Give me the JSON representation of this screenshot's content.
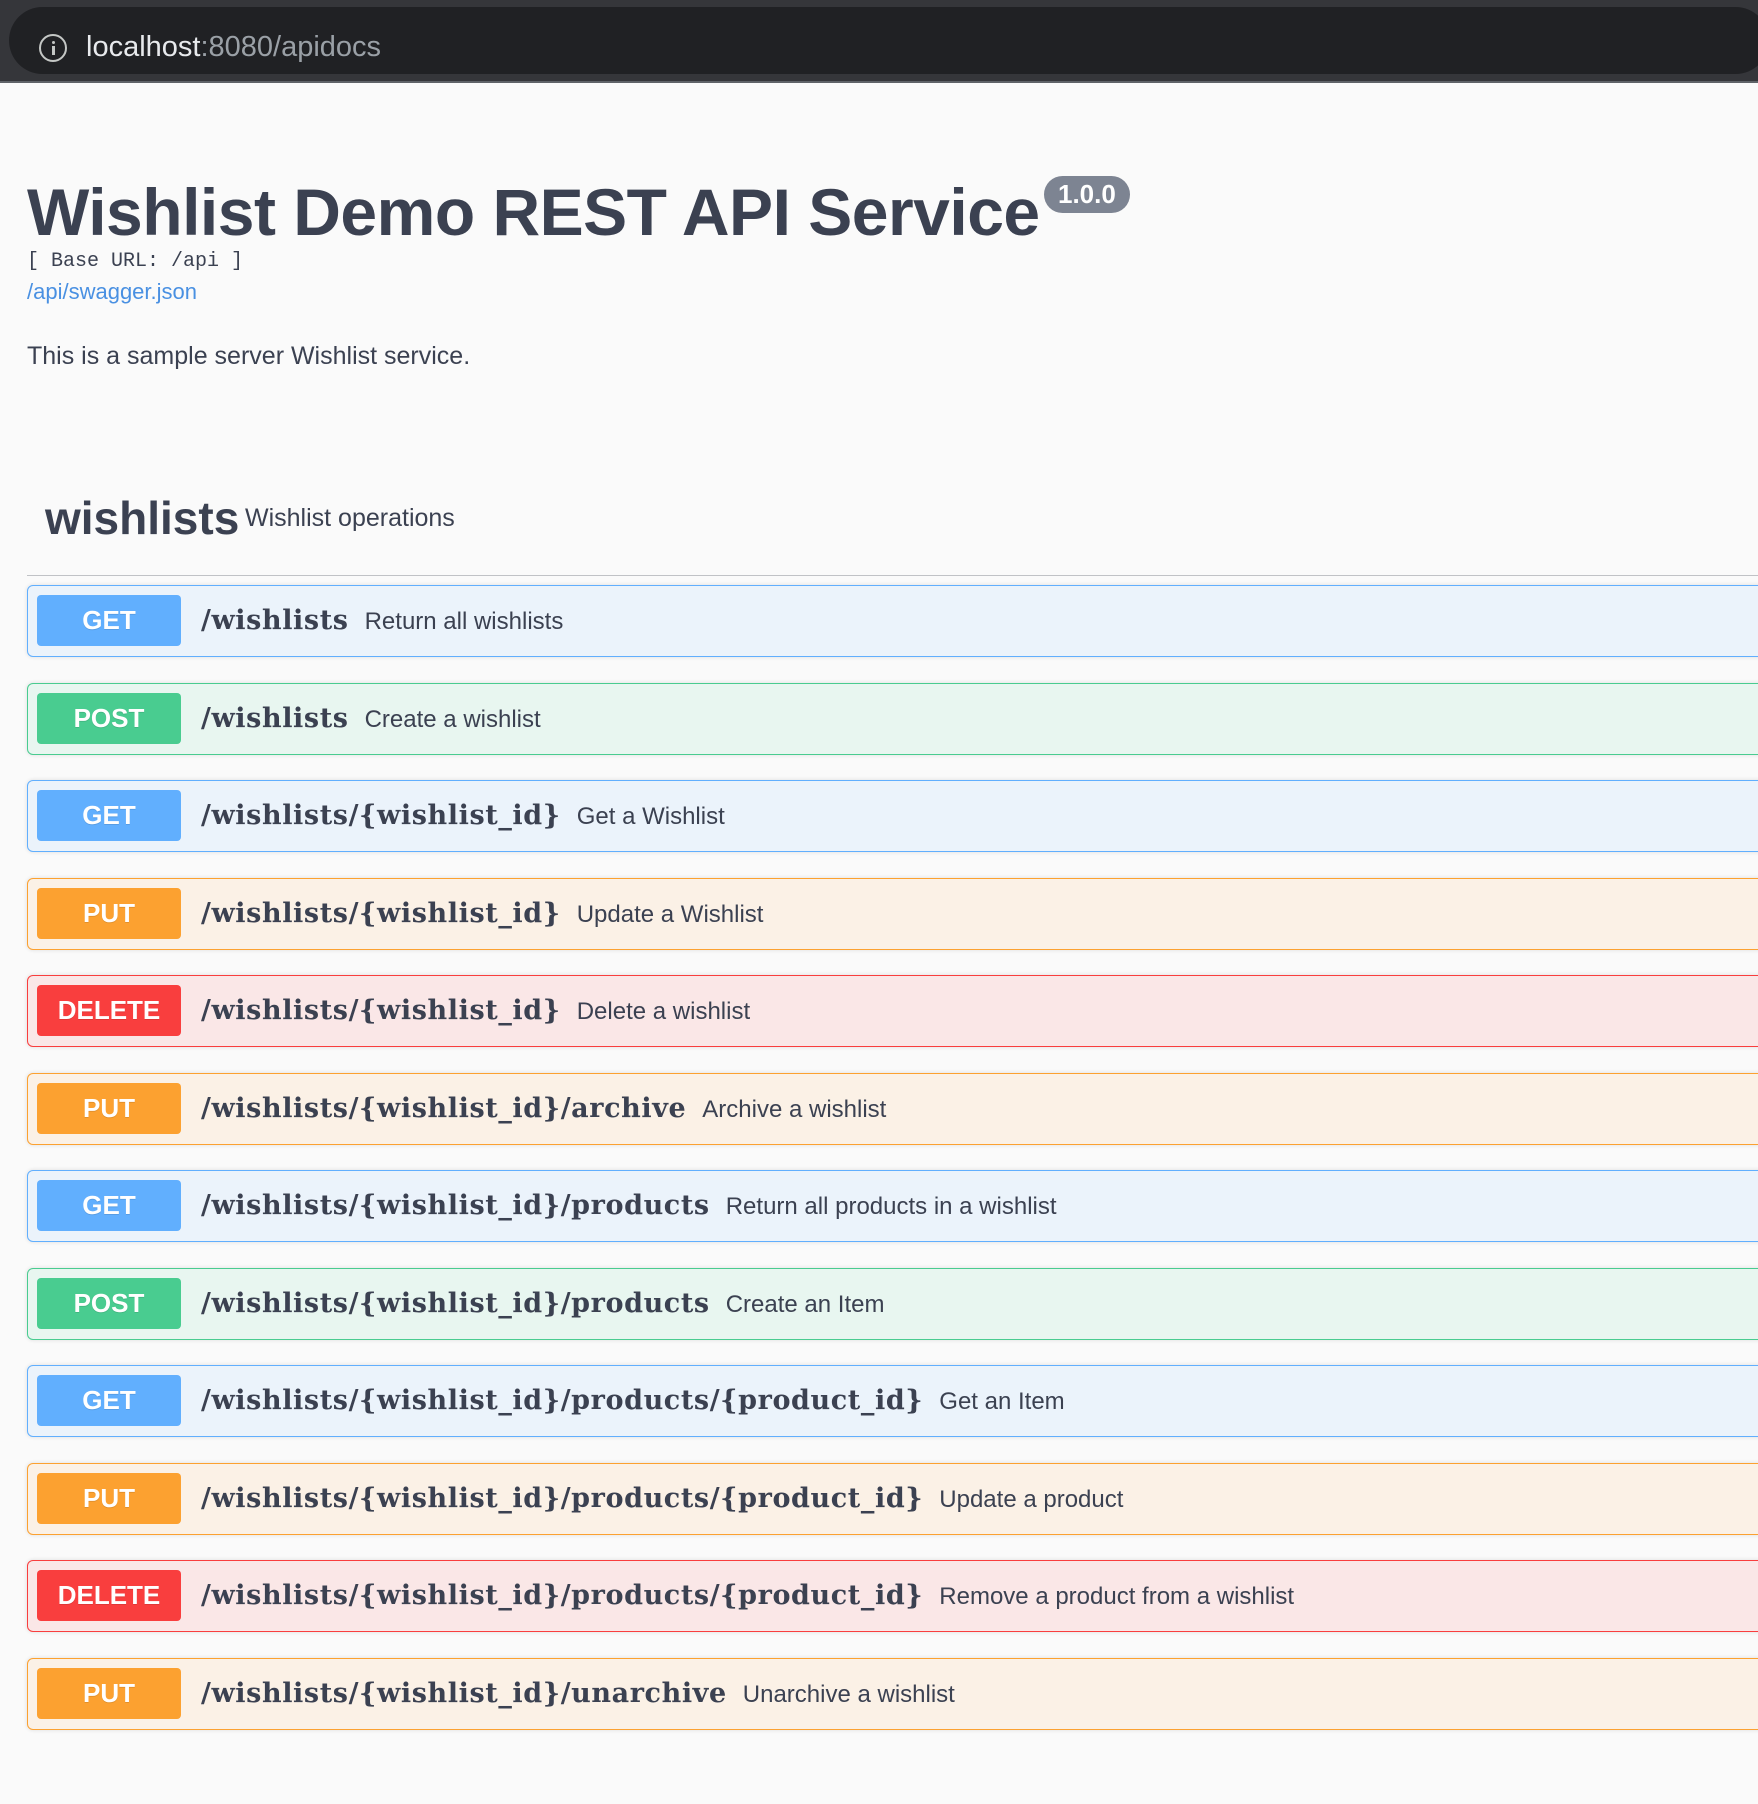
{
  "browser": {
    "url_host": "localhost",
    "url_path": ":8080/apidocs"
  },
  "info": {
    "title": "Wishlist Demo REST API Service",
    "version": "1.0.0",
    "base_url": "[ Base URL: /api ]",
    "spec_link": "/api/swagger.json",
    "description": "This is a sample server Wishlist service."
  },
  "tag": {
    "name": "wishlists",
    "description": "Wishlist operations"
  },
  "colors": {
    "get": "#61affe",
    "post": "#49cc90",
    "put": "#fca130",
    "delete": "#f93e3e"
  },
  "operations": [
    {
      "method": "GET",
      "path": "/wishlists",
      "summary": "Return all wishlists"
    },
    {
      "method": "POST",
      "path": "/wishlists",
      "summary": "Create a wishlist"
    },
    {
      "method": "GET",
      "path": "/wishlists/{wishlist_id}",
      "summary": "Get a Wishlist"
    },
    {
      "method": "PUT",
      "path": "/wishlists/{wishlist_id}",
      "summary": "Update a Wishlist"
    },
    {
      "method": "DELETE",
      "path": "/wishlists/{wishlist_id}",
      "summary": "Delete a wishlist"
    },
    {
      "method": "PUT",
      "path": "/wishlists/{wishlist_id}/archive",
      "summary": "Archive a wishlist"
    },
    {
      "method": "GET",
      "path": "/wishlists/{wishlist_id}/products",
      "summary": "Return all products in a wishlist"
    },
    {
      "method": "POST",
      "path": "/wishlists/{wishlist_id}/products",
      "summary": "Create an Item"
    },
    {
      "method": "GET",
      "path": "/wishlists/{wishlist_id}/products/{product_id}",
      "summary": "Get an Item"
    },
    {
      "method": "PUT",
      "path": "/wishlists/{wishlist_id}/products/{product_id}",
      "summary": "Update a product"
    },
    {
      "method": "DELETE",
      "path": "/wishlists/{wishlist_id}/products/{product_id}",
      "summary": "Remove a product from a wishlist"
    },
    {
      "method": "PUT",
      "path": "/wishlists/{wishlist_id}/unarchive",
      "summary": "Unarchive a wishlist"
    }
  ]
}
